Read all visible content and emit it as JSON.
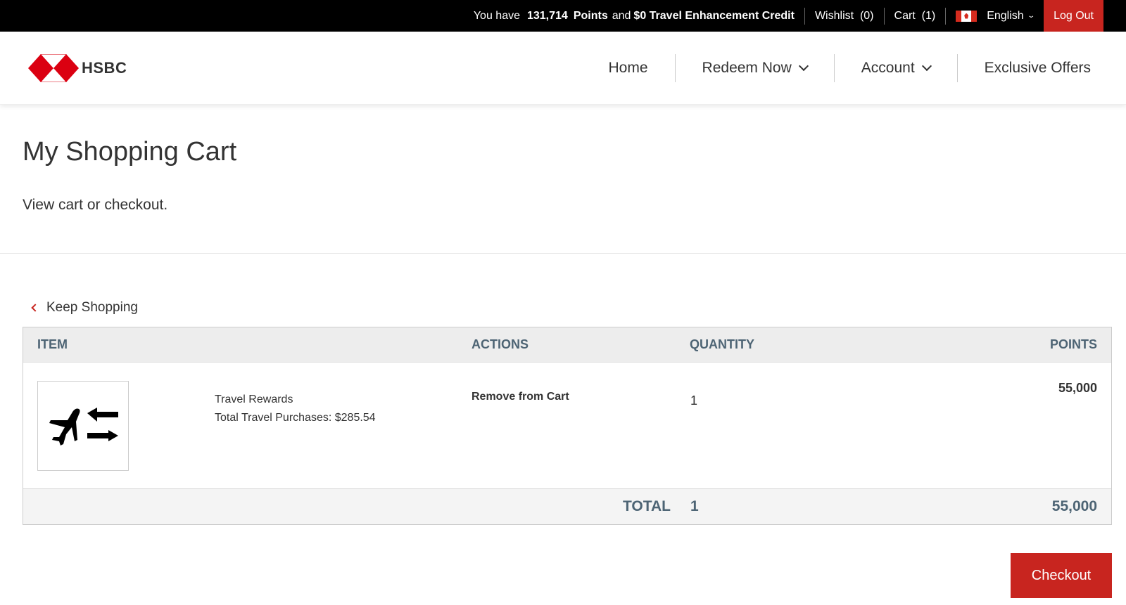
{
  "topbar": {
    "points_prefix": "You have",
    "points_value": "131,714",
    "points_label": "Points",
    "and_label": "and",
    "credit_label": "$0 Travel Enhancement Credit",
    "wishlist": "Wishlist  (0)",
    "cart": "Cart  (1)",
    "language": "English",
    "logout": "Log Out"
  },
  "brand": {
    "name": "HSBC",
    "color": "#db0011"
  },
  "nav": {
    "items": [
      {
        "label": "Home"
      },
      {
        "label": "Redeem Now"
      },
      {
        "label": "Account"
      },
      {
        "label": "Exclusive Offers"
      }
    ]
  },
  "page": {
    "title": "My Shopping Cart",
    "subtitle": "View cart or checkout."
  },
  "keep_shopping": "Keep Shopping",
  "cart": {
    "columns": {
      "item": "ITEM",
      "actions": "ACTIONS",
      "quantity": "QUANTITY",
      "points": "POINTS"
    },
    "rows": [
      {
        "icon": "flight-swap-icon",
        "name": "Travel Rewards",
        "detail": "Total Travel Purchases: $285.54",
        "action": "Remove from Cart",
        "quantity": "1",
        "points": "55,000"
      }
    ],
    "total": {
      "label": "TOTAL",
      "quantity": "1",
      "points": "55,000"
    }
  },
  "checkout_label": "Checkout",
  "accent_color": "#c8251f"
}
